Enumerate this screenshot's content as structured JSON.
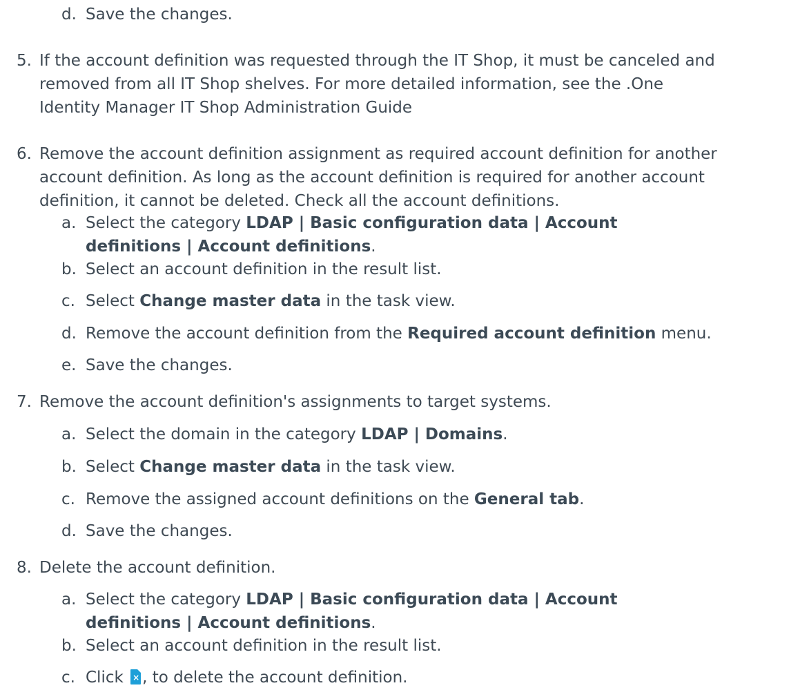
{
  "items": {
    "step4d": {
      "num": "d.",
      "text": "Save the changes."
    },
    "step5": {
      "num": "5.",
      "lines": [
        "If the account definition was requested through the IT Shop, it must be canceled and",
        "removed from all IT Shop shelves. For more detailed information, see the .One",
        "Identity Manager IT Shop Administration Guide"
      ]
    },
    "step6": {
      "num": "6.",
      "lines": [
        "Remove the account definition assignment as required account definition for another",
        "account definition. As long as the account definition is required for another account",
        "definition, it cannot be deleted. Check all the account definitions."
      ],
      "a": {
        "num": "a.",
        "pre": "Select the category ",
        "bold1": "LDAP | Basic configuration data | Account",
        "bold2": "definitions | Account definitions",
        "post": "."
      },
      "b": {
        "num": "b.",
        "text": "Select an account definition in the result list."
      },
      "c": {
        "num": "c.",
        "pre": "Select ",
        "bold": "Change master data",
        "post": " in the task view."
      },
      "d": {
        "num": "d.",
        "pre": "Remove the account definition from the ",
        "bold": "Required account definition",
        "post": " menu."
      },
      "e": {
        "num": "e.",
        "text": "Save the changes."
      }
    },
    "step7": {
      "num": "7.",
      "text": "Remove the account definition's assignments to target systems.",
      "a": {
        "num": "a.",
        "pre": "Select the domain in the category ",
        "bold": "LDAP | Domains",
        "post": "."
      },
      "b": {
        "num": "b.",
        "pre": "Select ",
        "bold": "Change master data",
        "post": " in the task view."
      },
      "c": {
        "num": "c.",
        "pre": "Remove the assigned account definitions on the ",
        "bold": "General tab",
        "post": "."
      },
      "d": {
        "num": "d.",
        "text": "Save the changes."
      }
    },
    "step8": {
      "num": "8.",
      "text": "Delete the account definition.",
      "a": {
        "num": "a.",
        "pre": "Select the category ",
        "bold1": "LDAP | Basic configuration data | Account",
        "bold2": "definitions | Account definitions",
        "post": "."
      },
      "b": {
        "num": "b.",
        "text": "Select an account definition in the result list."
      },
      "c": {
        "num": "c.",
        "pre": "Click ",
        "icon": "delete-document-icon",
        "post": ", to delete the account definition."
      }
    }
  },
  "colors": {
    "text": "#3f4a54",
    "icon": "#1d9fd8"
  }
}
